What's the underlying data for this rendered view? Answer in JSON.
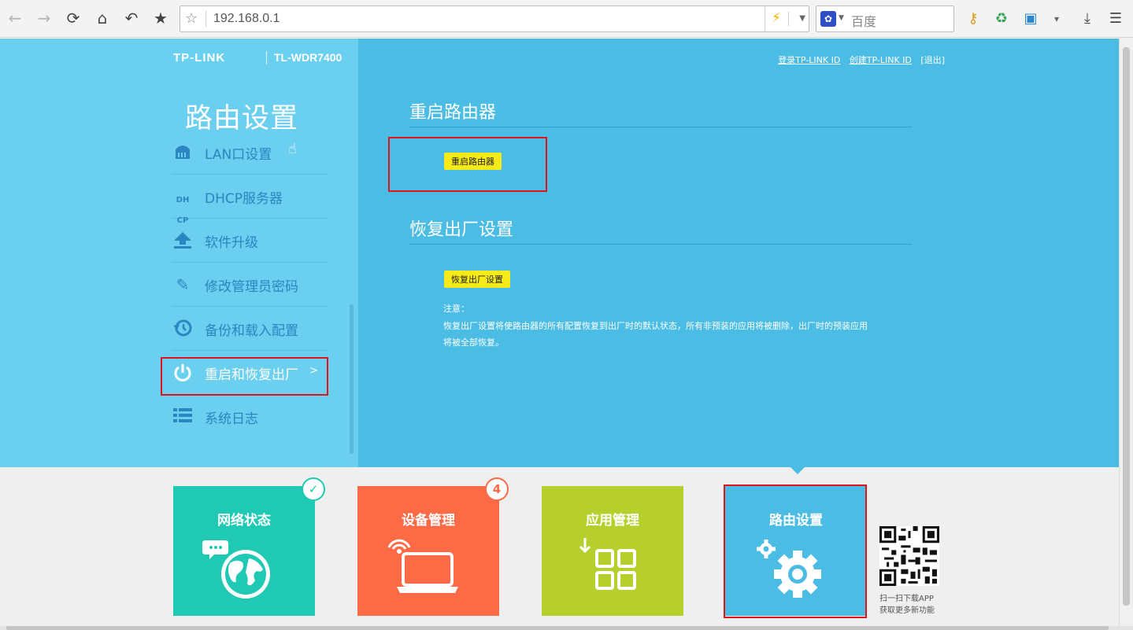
{
  "browser": {
    "url": "192.168.0.1",
    "search_placeholder": "百度",
    "icons": [
      "back-icon",
      "forward-icon",
      "reload-icon",
      "home-icon",
      "undo-icon",
      "bookmark-star-icon",
      "lightning-icon",
      "key-icon",
      "recycle-icon",
      "game-icon",
      "menu-dropdown-icon",
      "download-icon",
      "hamburger-menu-icon"
    ]
  },
  "header": {
    "brand": "TP-LINK",
    "model": "TL-WDR7400",
    "links": [
      "登录TP-LINK ID",
      "创建TP-LINK ID",
      "[退出]"
    ]
  },
  "sidebar": {
    "title": "路由设置",
    "items": [
      {
        "label": "LAN口设置",
        "icon": "lan-port-icon"
      },
      {
        "label": "DHCP服务器",
        "icon": "dhcp-icon"
      },
      {
        "label": "软件升级",
        "icon": "upload-icon"
      },
      {
        "label": "修改管理员密码",
        "icon": "pencil-icon"
      },
      {
        "label": "备份和载入配置",
        "icon": "history-icon"
      },
      {
        "label": "重启和恢复出厂",
        "icon": "power-icon",
        "active": true,
        "arrow": ">"
      },
      {
        "label": "系统日志",
        "icon": "list-icon"
      }
    ]
  },
  "main": {
    "reboot": {
      "heading": "重启路由器",
      "button": "重启路由器"
    },
    "factory": {
      "heading": "恢复出厂设置",
      "button": "恢复出厂设置",
      "note_title": "注意：",
      "note_line1": "恢复出厂设置将使路由器的所有配置恢复到出厂时的默认状态，所有非预装的应用将被删除，出厂时的预装应用",
      "note_line2": "将被全部恢复。"
    }
  },
  "tiles": [
    {
      "label": "网络状态",
      "color": "#1fc9b4",
      "badge": "✓"
    },
    {
      "label": "设备管理",
      "color": "#fd6b46",
      "badge": "4"
    },
    {
      "label": "应用管理",
      "color": "#b7cf2d"
    },
    {
      "label": "路由设置",
      "color": "#4bbde4",
      "active": true
    }
  ],
  "app_promo": {
    "line1": "扫一扫下载APP",
    "line2": "获取更多新功能"
  },
  "colors": {
    "left_panel": "#6bcfef",
    "right_panel": "#4bbde4",
    "highlight_box": "#e1141b",
    "action_button": "#f6ea18"
  }
}
